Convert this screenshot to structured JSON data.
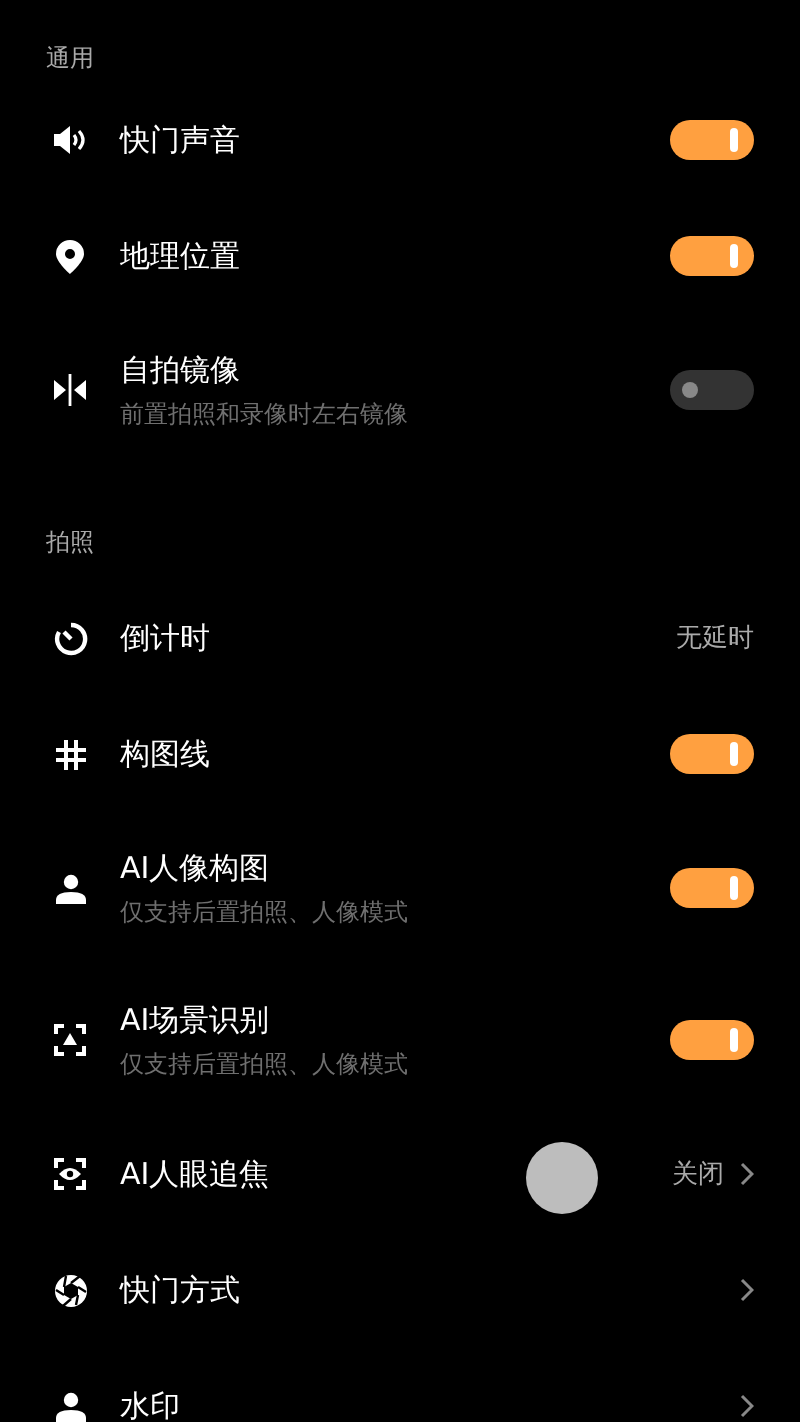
{
  "sections": [
    {
      "title": "通用",
      "items": [
        {
          "kind": "toggle",
          "label": "快门声音",
          "on": true
        },
        {
          "kind": "toggle",
          "label": "地理位置",
          "on": true
        },
        {
          "kind": "toggle",
          "label": "自拍镜像",
          "sublabel": "前置拍照和录像时左右镜像",
          "on": false
        }
      ]
    },
    {
      "title": "拍照",
      "items": [
        {
          "kind": "value",
          "label": "倒计时",
          "value": "无延时"
        },
        {
          "kind": "toggle",
          "label": "构图线",
          "on": true
        },
        {
          "kind": "toggle",
          "label": "AI人像构图",
          "sublabel": "仅支持后置拍照、人像模式",
          "on": true
        },
        {
          "kind": "toggle",
          "label": "AI场景识别",
          "sublabel": "仅支持后置拍照、人像模式",
          "on": true
        },
        {
          "kind": "link",
          "label": "AI人眼追焦",
          "value": "关闭"
        },
        {
          "kind": "link",
          "label": "快门方式"
        },
        {
          "kind": "link",
          "label": "水印"
        }
      ]
    }
  ]
}
